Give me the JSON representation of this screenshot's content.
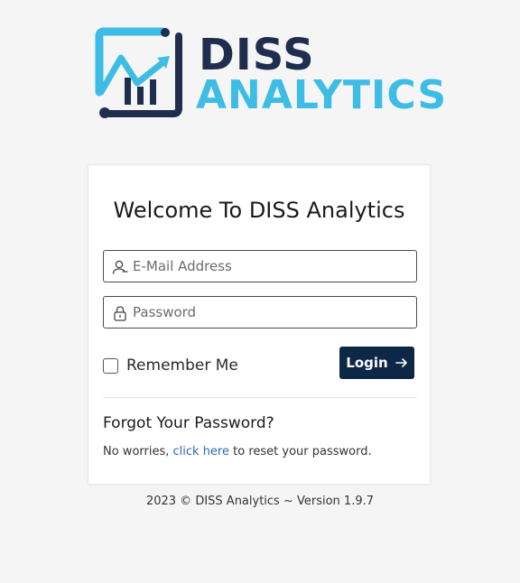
{
  "logo": {
    "line1": "DISS",
    "line2": "ANALYTICS",
    "colors": {
      "dark": "#1f2d4f",
      "accent": "#3dbde5"
    }
  },
  "card": {
    "title": "Welcome To DISS Analytics",
    "email": {
      "placeholder": "E-Mail Address",
      "value": "",
      "icon": "user-icon"
    },
    "password": {
      "placeholder": "Password",
      "value": "",
      "icon": "lock-icon"
    },
    "remember_label": "Remember Me",
    "remember_checked": false,
    "login_label": "Login",
    "login_icon": "arrow-right-icon",
    "forgot_title": "Forgot Your Password?",
    "forgot_prefix": "No worries,",
    "forgot_link": "click here",
    "forgot_suffix": "to reset your password."
  },
  "footer": "2023 © DISS Analytics ~ Version 1.9.7",
  "theme": {
    "button": "#0d2847",
    "link": "#2b6cb0",
    "background": "#f5f5f5"
  }
}
